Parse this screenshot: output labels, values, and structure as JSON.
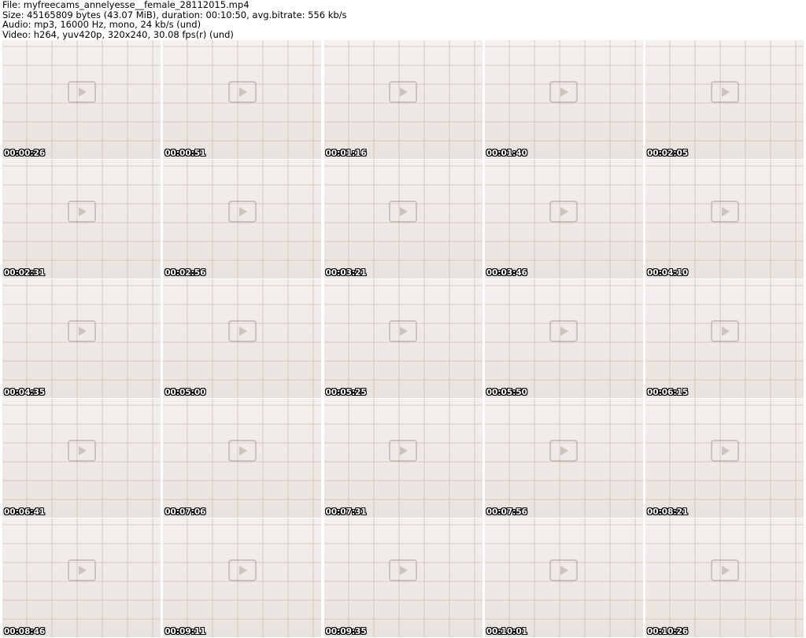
{
  "header": {
    "file_line": "File: myfreecams_annelyesse__female_28112015.mp4",
    "size_line": "Size: 45165809 bytes (43.07 MiB), duration: 00:10:50, avg.bitrate: 556 kb/s",
    "audio_line": "Audio: mp3, 16000 Hz, mono, 24 kb/s (und)",
    "video_line": "Video: h264, yuv420p, 320x240, 30.08 fps(r) (und)"
  },
  "thumbnails": [
    {
      "timestamp": "00:00:26",
      "icon": "video-frame-icon"
    },
    {
      "timestamp": "00:00:51",
      "icon": "video-frame-icon"
    },
    {
      "timestamp": "00:01:16",
      "icon": "video-frame-icon"
    },
    {
      "timestamp": "00:01:40",
      "icon": "video-frame-icon"
    },
    {
      "timestamp": "00:02:05",
      "icon": "video-frame-icon"
    },
    {
      "timestamp": "00:02:31",
      "icon": "video-frame-icon"
    },
    {
      "timestamp": "00:02:56",
      "icon": "video-frame-icon"
    },
    {
      "timestamp": "00:03:21",
      "icon": "video-frame-icon"
    },
    {
      "timestamp": "00:03:46",
      "icon": "video-frame-icon"
    },
    {
      "timestamp": "00:04:10",
      "icon": "video-frame-icon"
    },
    {
      "timestamp": "00:04:35",
      "icon": "video-frame-icon"
    },
    {
      "timestamp": "00:05:00",
      "icon": "video-frame-icon"
    },
    {
      "timestamp": "00:05:25",
      "icon": "video-frame-icon"
    },
    {
      "timestamp": "00:05:50",
      "icon": "video-frame-icon"
    },
    {
      "timestamp": "00:06:15",
      "icon": "video-frame-icon"
    },
    {
      "timestamp": "00:06:41",
      "icon": "video-frame-icon"
    },
    {
      "timestamp": "00:07:06",
      "icon": "video-frame-icon"
    },
    {
      "timestamp": "00:07:31",
      "icon": "video-frame-icon"
    },
    {
      "timestamp": "00:07:56",
      "icon": "video-frame-icon"
    },
    {
      "timestamp": "00:08:21",
      "icon": "video-frame-icon"
    },
    {
      "timestamp": "00:08:46",
      "icon": "video-frame-icon"
    },
    {
      "timestamp": "00:09:11",
      "icon": "video-frame-icon"
    },
    {
      "timestamp": "00:09:35",
      "icon": "video-frame-icon"
    },
    {
      "timestamp": "00:10:01",
      "icon": "video-frame-icon"
    },
    {
      "timestamp": "00:10:26",
      "icon": "video-frame-icon"
    }
  ],
  "colors": {
    "background": "#ffffff",
    "header_text": "#000000",
    "stamp_text": "#ffffff",
    "stamp_outline": "#000000"
  }
}
